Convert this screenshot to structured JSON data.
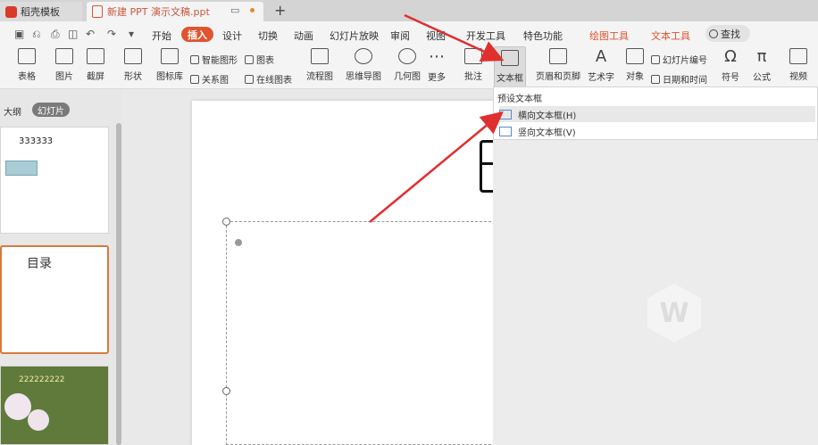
{
  "tabs": {
    "template_tab": "稻壳模板",
    "doc_tab": "新建 PPT 演示文稿.ppt",
    "new_tab": "+"
  },
  "menu": {
    "items": [
      "开始",
      "插入",
      "设计",
      "切换",
      "动画",
      "幻灯片放映",
      "审阅",
      "视图",
      "开发工具",
      "特色功能",
      "绘图工具",
      "文本工具"
    ],
    "active": "插入",
    "search": "查找"
  },
  "ribbon": {
    "table": "表格",
    "picture": "图片",
    "screenshot": "截屏",
    "shape": "形状",
    "icon_lib": "图标库",
    "smart_shape": "智能图形",
    "chart": "图表",
    "relation": "关系图",
    "online_chart": "在线图表",
    "flowchart": "流程图",
    "mindmap": "思维导图",
    "geometry": "几何图",
    "more": "更多",
    "comment": "批注",
    "textbox": "文本框",
    "header_footer": "页眉和页脚",
    "wordart": "艺术字",
    "object": "对象",
    "slide_number": "幻灯片编号",
    "datetime": "日期和时间",
    "symbol": "符号",
    "formula": "公式",
    "video": "视频"
  },
  "left_panel": {
    "outline_tab": "大纲",
    "slides_tab": "幻灯片",
    "slide1_text": "333333",
    "slide2_text": "目录",
    "slide3_text": "222222222"
  },
  "dropdown": {
    "header": "预设文本框",
    "horizontal": "横向文本框(H)",
    "vertical": "竖向文本框(V)"
  },
  "colors": {
    "accent": "#e0542f",
    "arrow": "#e02f2f"
  }
}
